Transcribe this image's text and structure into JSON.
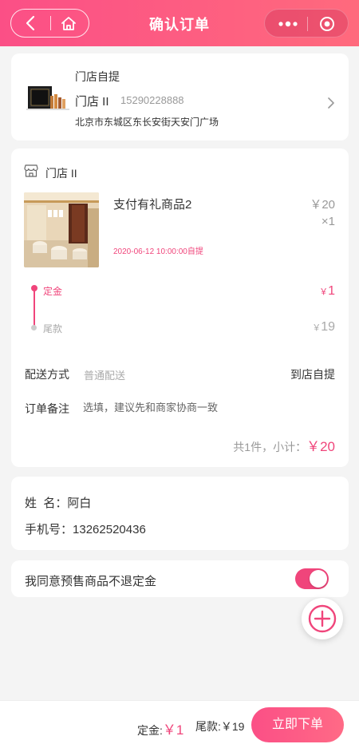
{
  "header": {
    "title": "确认订单"
  },
  "address": {
    "type": "门店自提",
    "name": "门店 II",
    "phone": "15290228888",
    "detail": "北京市东城区东长安街天安门广场"
  },
  "order": {
    "store_name": "门店 II",
    "goods": {
      "title": "支付有礼商品2",
      "price": "￥20",
      "qty": "×1",
      "pickup_date": "2020-06-12 10:00:00自提"
    },
    "deposit": {
      "label": "定金",
      "currency": "￥",
      "amount": "1"
    },
    "balance": {
      "label": "尾款",
      "currency": "￥",
      "amount": "19"
    },
    "shipping": {
      "label": "配送方式",
      "hint": "普通配送",
      "value": "到店自提"
    },
    "note": {
      "label": "订单备注",
      "placeholder": "选填，建议先和商家协商一致"
    },
    "subtotal": {
      "label": "共1件，小计：",
      "value": "￥20"
    }
  },
  "contact": {
    "name_label": "姓  名：",
    "name": "阿白",
    "phone_label": "手机号：",
    "phone": "13262520436"
  },
  "agree": {
    "text": "我同意预售商品不退定金",
    "checked": true
  },
  "footer": {
    "deposit_label": "定金:",
    "deposit_value": "￥1",
    "balance_label": "尾款:",
    "balance_value": "￥19",
    "submit_label": "立即下单"
  },
  "colors": {
    "accent": "#f0457b",
    "header_start": "#fb4f86",
    "header_end": "#ff6a7d"
  }
}
